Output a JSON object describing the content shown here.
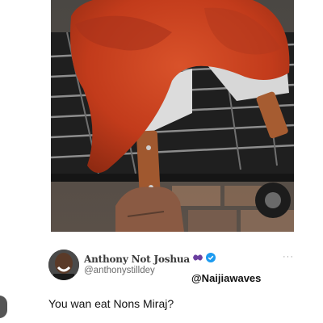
{
  "post": {
    "author_name": "Anthony Not Joshua",
    "handle": "@anthonystilldey",
    "text": "You wan eat Nons Miraj?",
    "more_label": "···",
    "verified_icon": "verified-badge-icon",
    "emoji_icon": "purple-glyph-emoji-icon"
  },
  "watermark": "@Naijiawaves",
  "colors": {
    "chicken": "#c8401f",
    "verified": "#1d9bf0",
    "grill": "#2b2b2b"
  }
}
